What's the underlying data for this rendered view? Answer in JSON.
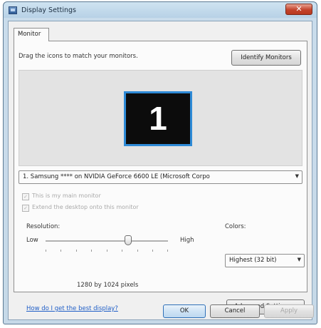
{
  "window": {
    "title": "Display Settings",
    "close_glyph": "✕"
  },
  "tabs": [
    {
      "label": "Monitor"
    }
  ],
  "monitor": {
    "instruction": "Drag the icons to match your monitors.",
    "identify_button": "Identify Monitors",
    "monitor_number": "1",
    "display_selected": "1. Samsung **** on NVIDIA GeForce 6600 LE (Microsoft Corpo",
    "main_monitor_label": "This is my main monitor",
    "extend_desktop_label": "Extend the desktop onto this monitor",
    "main_monitor_checked": true,
    "extend_desktop_checked": true
  },
  "resolution": {
    "label": "Resolution:",
    "low_label": "Low",
    "high_label": "High",
    "value_text": "1280 by 1024 pixels",
    "slider_level_fraction": 0.65
  },
  "colors": {
    "label": "Colors:",
    "selected": "Highest (32 bit)"
  },
  "help_link": "How do I get the best display?",
  "advanced_button": "Advanced Settings...",
  "footer": {
    "ok": "OK",
    "cancel": "Cancel",
    "apply": "Apply"
  },
  "icons": {
    "app": "display-settings-icon",
    "dropdown": "chevron-down-icon",
    "check": "checkmark-icon"
  },
  "theme": {
    "accent": "#2e8ad6",
    "link": "#1f5ec7",
    "close": "#c4442c"
  }
}
